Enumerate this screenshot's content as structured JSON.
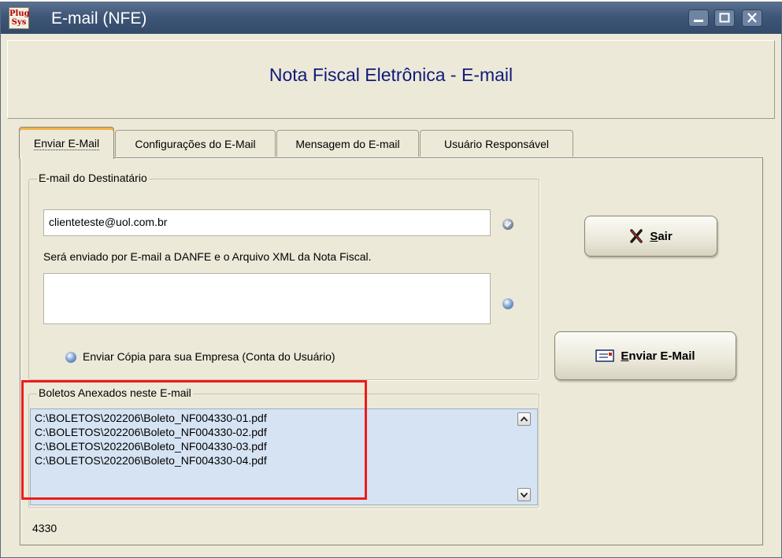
{
  "window": {
    "title": "E-mail (NFE)",
    "app_icon_text": [
      "Plug",
      "Sys"
    ]
  },
  "header": {
    "title": "Nota Fiscal Eletrônica - E-mail"
  },
  "tabs": [
    {
      "label": "Enviar E-Mail",
      "active": true
    },
    {
      "label": "Configurações do E-Mail",
      "active": false
    },
    {
      "label": "Mensagem do E-mail",
      "active": false
    },
    {
      "label": "Usuário Responsável",
      "active": false
    }
  ],
  "recipient": {
    "group_label": "E-mail do Destinatário",
    "email_value": "clienteteste@uol.com.br",
    "info_text": "Será enviado por E-mail a DANFE e o Arquivo XML da Nota Fiscal.",
    "second_field_value": "",
    "copy_option_label": "Enviar Cópia para sua Empresa (Conta do Usuário)"
  },
  "buttons": {
    "exit_prefix": "S",
    "exit_rest": "air",
    "send_prefix": "E",
    "send_rest": "nviar E-Mail"
  },
  "attachments": {
    "group_label": "Boletos Anexados neste E-mail",
    "files": [
      "C:\\BOLETOS\\202206\\Boleto_NF004330-01.pdf",
      "C:\\BOLETOS\\202206\\Boleto_NF004330-02.pdf",
      "C:\\BOLETOS\\202206\\Boleto_NF004330-03.pdf",
      "C:\\BOLETOS\\202206\\Boleto_NF004330-04.pdf"
    ]
  },
  "footer": {
    "number": "4330"
  },
  "colors": {
    "highlight": "#ef1a1a",
    "title_bar": "#3e5677",
    "header_text": "#101a7a",
    "list_bg": "#d5e3f3"
  }
}
